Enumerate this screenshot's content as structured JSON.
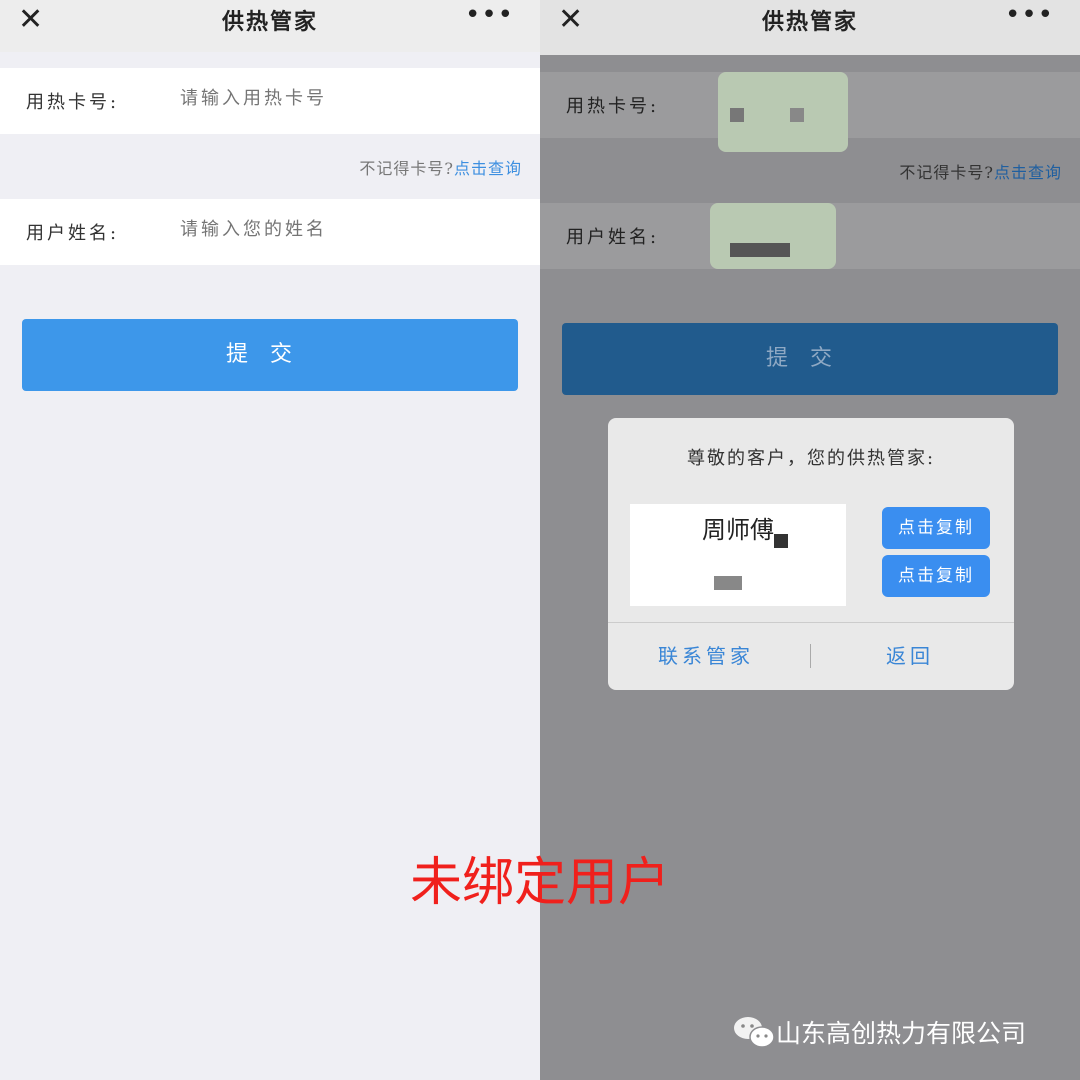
{
  "left": {
    "header": {
      "title": "供热管家",
      "close_icon": "close-icon",
      "more_icon": "more-icon"
    },
    "card_label": "用热卡号:",
    "card_placeholder": "请输入用热卡号",
    "hint_text": "不记得卡号?",
    "hint_link": "点击查询",
    "name_label": "用户姓名:",
    "name_placeholder": "请输入您的姓名",
    "submit": "提交"
  },
  "right": {
    "header": {
      "title": "供热管家"
    },
    "card_label": "用热卡号:",
    "hint_text": "不记得卡号?",
    "hint_link": "点击查询",
    "name_label": "用户姓名:",
    "submit": "提交",
    "dialog": {
      "title": "尊敬的客户，您的供热管家:",
      "name": "周师傅",
      "copy1": "点击复制",
      "copy2": "点击复制",
      "contact": "联系管家",
      "back": "返回"
    }
  },
  "caption": "未绑定用户",
  "watermark": {
    "icon": "wechat-icon",
    "text": "山东高创热力有限公司"
  },
  "colors": {
    "primary": "#3d97ea",
    "link": "#3d8fe0",
    "caption": "#f0201c"
  }
}
